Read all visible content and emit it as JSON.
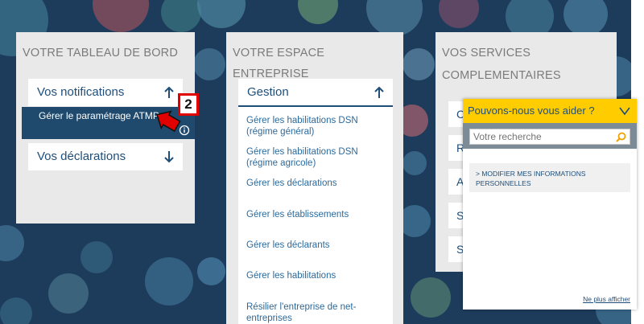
{
  "dashboard": {
    "title": "VOTRE TABLEAU DE BORD",
    "notifications_label": "Vos notifications",
    "submenu_item": "Gérer le paramétrage ATMP",
    "declarations_label": "Vos déclarations"
  },
  "callout": {
    "number": "2",
    "color": "#e00000"
  },
  "enterprise": {
    "title": "VOTRE ESPACE ENTREPRISE",
    "section_label": "Gestion",
    "links": [
      "Gérer les habilitations DSN (régime général)",
      "Gérer les habilitations DSN (régime agricole)",
      "Gérer les déclarations",
      "Gérer les établissements",
      "Gérer les déclarants",
      "Gérer les habilitations",
      "Résilier l'entreprise de net-entreprises"
    ]
  },
  "services": {
    "title_line1": "VOS SERVICES",
    "title_line2": "COMPLEMENTAIRES",
    "stub_letters": [
      "C",
      "R",
      "A",
      "S",
      "S"
    ]
  },
  "help": {
    "title": "Pouvons-nous vous aider ?",
    "search_placeholder": "Votre recherche",
    "suggestion": "> MODIFIER MES INFORMATIONS PERSONNELLES",
    "footer_link": "Ne plus afficher"
  },
  "colors": {
    "background": "#1d3c5c",
    "accent_blue": "#1f4e79",
    "help_yellow": "#ffcc00",
    "link_blue": "#2b6a9c"
  }
}
